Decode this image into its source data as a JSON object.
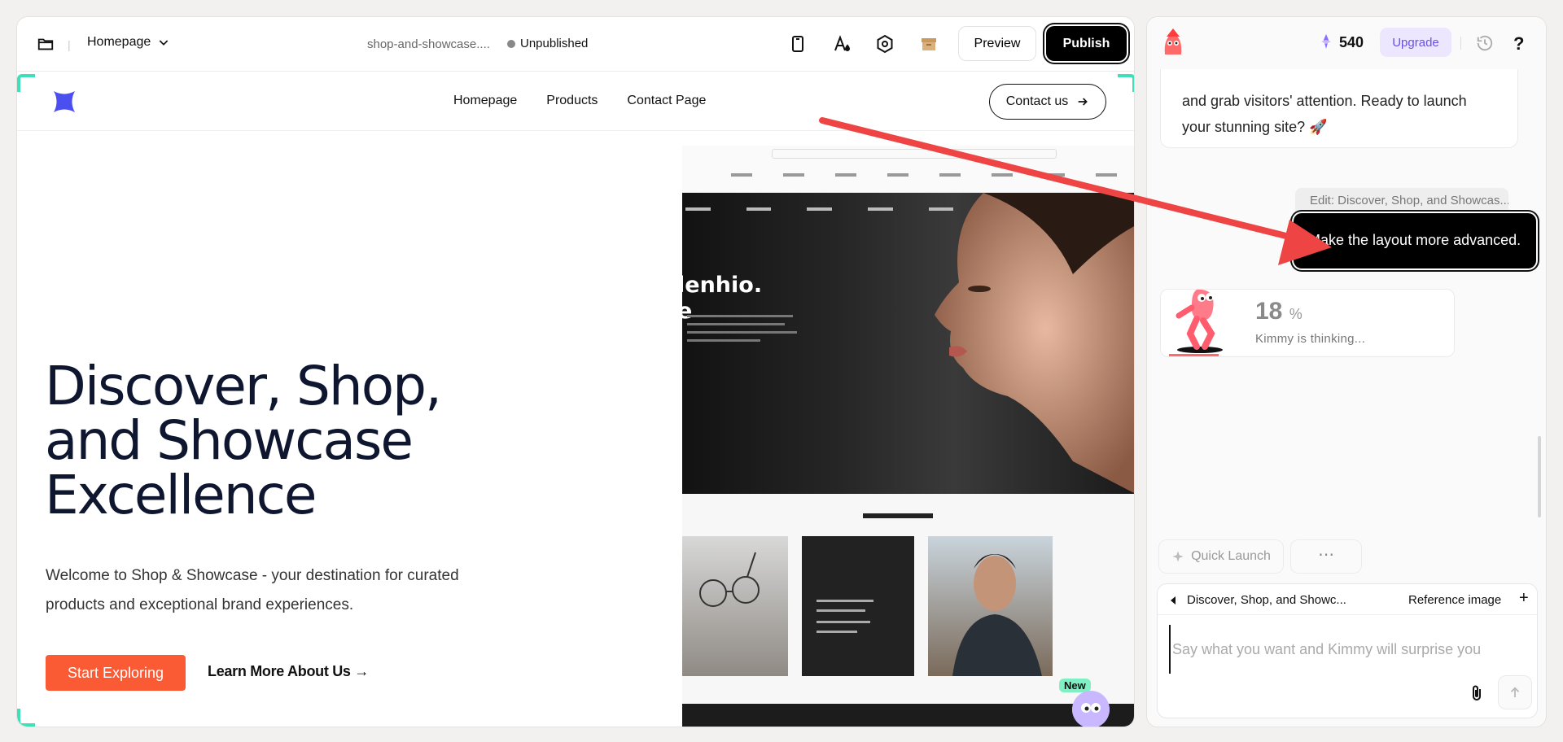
{
  "editor": {
    "page_selector": "Homepage",
    "site_name": "shop-and-showcase....",
    "status": "Unpublished",
    "preview_label": "Preview",
    "publish_label": "Publish"
  },
  "site": {
    "nav": [
      "Homepage",
      "Products",
      "Contact Page"
    ],
    "contact_label": "Contact us",
    "hero_title": "Discover, Shop, and Showcase Excellence",
    "hero_subtitle": "Welcome to Shop & Showcase - your destination for curated products and exceptional brand experiences.",
    "start_label": "Start Exploring",
    "learn_label": "Learn More About Us →",
    "new_badge": "New"
  },
  "mockup": {
    "headline_1": "lenhio.",
    "headline_2": "e"
  },
  "chat": {
    "credits": "540",
    "upgrade_label": "Upgrade",
    "help": "?",
    "bot_message": "and grab visitors' attention. Ready to launch your stunning site? 🚀",
    "edit_chip": "Edit:  Discover, Shop, and Showcas...",
    "user_message": "Make the layout more advanced.",
    "progress_value": "18",
    "progress_unit": "%",
    "progress_fraction": 0.18,
    "thinking_text": "Kimmy is thinking...",
    "quick_launch_label": "Quick Launch",
    "more_label": "⋯",
    "context_label": "Discover, Shop, and Showc...",
    "reference_label": "Reference image",
    "plus": "+",
    "input_placeholder": "Say what you want and Kimmy will surprise you"
  },
  "colors": {
    "accent_orange": "#fa5a34",
    "frame_teal": "#3ee0b8",
    "annotation_red": "#ef4444",
    "upgrade_purple": "#6b4fe0"
  }
}
